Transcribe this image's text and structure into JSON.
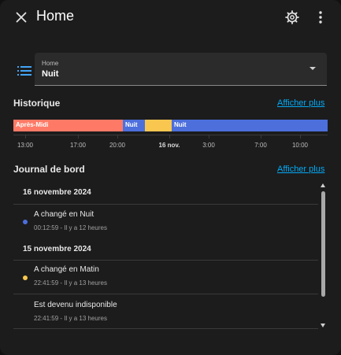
{
  "dialog": {
    "title": "Home",
    "icons": {
      "close": "close-icon",
      "settings": "gear-icon",
      "more": "more-vertical-icon",
      "list": "list-icon"
    }
  },
  "select": {
    "label": "Home",
    "value": "Nuit"
  },
  "history": {
    "title": "Historique",
    "more_link": "Afficher plus",
    "segments": [
      {
        "label": "Après-Midi",
        "color": "#ff7a66"
      },
      {
        "label": "Nuit",
        "color": "#4c6fdc"
      },
      {
        "label": "",
        "color": "#f9c74f"
      },
      {
        "label": "Nuit",
        "color": "#4c6fdc"
      }
    ],
    "ticks": [
      {
        "label": "13:00",
        "bold": false
      },
      {
        "label": "17:00",
        "bold": false
      },
      {
        "label": "20:00",
        "bold": false
      },
      {
        "label": "16 nov.",
        "bold": true
      },
      {
        "label": "3:00",
        "bold": false
      },
      {
        "label": "7:00",
        "bold": false
      },
      {
        "label": "10:00",
        "bold": false
      }
    ]
  },
  "logbook": {
    "title": "Journal de bord",
    "more_link": "Afficher plus",
    "groups": [
      {
        "date": "16 novembre 2024",
        "entries": [
          {
            "title": "A changé en Nuit",
            "time": "00:12:59 - Il y a 12 heures",
            "dot_color": "#4c6fdc"
          }
        ]
      },
      {
        "date": "15 novembre 2024",
        "entries": [
          {
            "title": "A changé en Matin",
            "time": "22:41:59 - Il y a 13 heures",
            "dot_color": "#f9c74f"
          },
          {
            "title": "Est devenu indisponible",
            "time": "22:41:59 - Il y a 13 heures",
            "dot_color": ""
          }
        ]
      }
    ]
  }
}
